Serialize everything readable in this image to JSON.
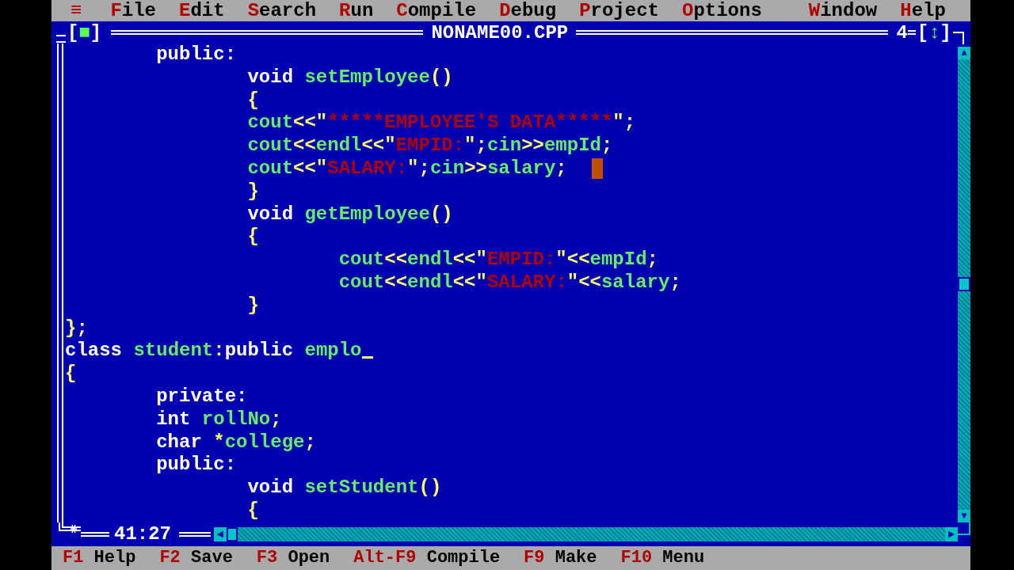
{
  "menu_bar": {
    "items": [
      {
        "label": "File"
      },
      {
        "label": "Edit"
      },
      {
        "label": "Search"
      },
      {
        "label": "Run"
      },
      {
        "label": "Compile"
      },
      {
        "label": "Debug"
      },
      {
        "label": "Project"
      },
      {
        "label": "Options"
      },
      {
        "label": "Window"
      },
      {
        "label": "Help"
      }
    ],
    "system_menu": "≡"
  },
  "editor": {
    "title": "NONAME00.CPP",
    "close_button": "[■]",
    "window_number": "4",
    "zoom_button": "[↕]",
    "position": "41:27",
    "vertical_scrollbar": {
      "up": "▲",
      "down": "▼"
    },
    "horizontal_scrollbar": {
      "left": "◄",
      "right": "►"
    },
    "lines": [
      {
        "tokens": [
          {
            "kind": "kw",
            "text": "        public:"
          }
        ]
      },
      {
        "tokens": [
          {
            "kind": "kw",
            "text": "                void "
          },
          {
            "kind": "id",
            "text": "setEmployee"
          },
          {
            "kind": "sym",
            "text": "()"
          }
        ]
      },
      {
        "tokens": [
          {
            "kind": "sym",
            "text": "                {"
          }
        ]
      },
      {
        "tokens": [
          {
            "kind": "id",
            "text": "                cout"
          },
          {
            "kind": "sym",
            "text": "<<\""
          },
          {
            "kind": "str",
            "text": "*****EMPLOYEE'S DATA*****"
          },
          {
            "kind": "sym",
            "text": "\";"
          }
        ]
      },
      {
        "tokens": [
          {
            "kind": "id",
            "text": "                cout"
          },
          {
            "kind": "sym",
            "text": "<<"
          },
          {
            "kind": "id",
            "text": "endl"
          },
          {
            "kind": "sym",
            "text": "<<\""
          },
          {
            "kind": "str",
            "text": "EMPID:"
          },
          {
            "kind": "sym",
            "text": "\";"
          },
          {
            "kind": "id",
            "text": "cin"
          },
          {
            "kind": "sym",
            "text": ">>"
          },
          {
            "kind": "id",
            "text": "empId"
          },
          {
            "kind": "sym",
            "text": ";"
          }
        ]
      },
      {
        "tokens": [
          {
            "kind": "id",
            "text": "                cout"
          },
          {
            "kind": "sym",
            "text": "<<\""
          },
          {
            "kind": "str",
            "text": "SALARY:"
          },
          {
            "kind": "sym",
            "text": "\";"
          },
          {
            "kind": "id",
            "text": "cin"
          },
          {
            "kind": "sym",
            "text": ">>"
          },
          {
            "kind": "id",
            "text": "salary"
          },
          {
            "kind": "sym",
            "text": ";"
          }
        ],
        "block_cursor": true
      },
      {
        "tokens": [
          {
            "kind": "sym",
            "text": "                }"
          }
        ]
      },
      {
        "tokens": [
          {
            "kind": "kw",
            "text": "                void "
          },
          {
            "kind": "id",
            "text": "getEmployee"
          },
          {
            "kind": "sym",
            "text": "()"
          }
        ]
      },
      {
        "tokens": [
          {
            "kind": "sym",
            "text": "                {"
          }
        ]
      },
      {
        "tokens": [
          {
            "kind": "id",
            "text": "                        cout"
          },
          {
            "kind": "sym",
            "text": "<<"
          },
          {
            "kind": "id",
            "text": "endl"
          },
          {
            "kind": "sym",
            "text": "<<\""
          },
          {
            "kind": "str",
            "text": "EMPID:"
          },
          {
            "kind": "sym",
            "text": "\"<<"
          },
          {
            "kind": "id",
            "text": "empId"
          },
          {
            "kind": "sym",
            "text": ";"
          }
        ]
      },
      {
        "tokens": [
          {
            "kind": "id",
            "text": "                        cout"
          },
          {
            "kind": "sym",
            "text": "<<"
          },
          {
            "kind": "id",
            "text": "endl"
          },
          {
            "kind": "sym",
            "text": "<<\""
          },
          {
            "kind": "str",
            "text": "SALARY:"
          },
          {
            "kind": "sym",
            "text": "\"<<"
          },
          {
            "kind": "id",
            "text": "salary"
          },
          {
            "kind": "sym",
            "text": ";"
          }
        ]
      },
      {
        "tokens": [
          {
            "kind": "sym",
            "text": "                }"
          }
        ]
      },
      {
        "tokens": [
          {
            "kind": "sym",
            "text": "};"
          }
        ]
      },
      {
        "tokens": [
          {
            "kind": "kw",
            "text": "class "
          },
          {
            "kind": "id",
            "text": "student"
          },
          {
            "kind": "sym",
            "text": ":"
          },
          {
            "kind": "kw",
            "text": "public "
          },
          {
            "kind": "id",
            "text": "emplo"
          }
        ],
        "underline_cursor": true
      },
      {
        "tokens": [
          {
            "kind": "sym",
            "text": "{"
          }
        ]
      },
      {
        "tokens": [
          {
            "kind": "kw",
            "text": "        private:"
          }
        ]
      },
      {
        "tokens": [
          {
            "kind": "kw",
            "text": "        int "
          },
          {
            "kind": "id",
            "text": "rollNo"
          },
          {
            "kind": "sym",
            "text": ";"
          }
        ]
      },
      {
        "tokens": [
          {
            "kind": "kw",
            "text": "        char "
          },
          {
            "kind": "sym",
            "text": "*"
          },
          {
            "kind": "id",
            "text": "college"
          },
          {
            "kind": "sym",
            "text": ";"
          }
        ]
      },
      {
        "tokens": [
          {
            "kind": "kw",
            "text": "        public:"
          }
        ]
      },
      {
        "tokens": [
          {
            "kind": "kw",
            "text": "                void "
          },
          {
            "kind": "id",
            "text": "setStudent"
          },
          {
            "kind": "sym",
            "text": "()"
          }
        ]
      },
      {
        "tokens": [
          {
            "kind": "sym",
            "text": "                {"
          }
        ]
      }
    ]
  },
  "status_bar": {
    "items": [
      {
        "key": "F1",
        "label": "Help"
      },
      {
        "key": "F2",
        "label": "Save"
      },
      {
        "key": "F3",
        "label": "Open"
      },
      {
        "key": "Alt-F9",
        "label": "Compile"
      },
      {
        "key": "F9",
        "label": "Make"
      },
      {
        "key": "F10",
        "label": "Menu"
      }
    ]
  }
}
